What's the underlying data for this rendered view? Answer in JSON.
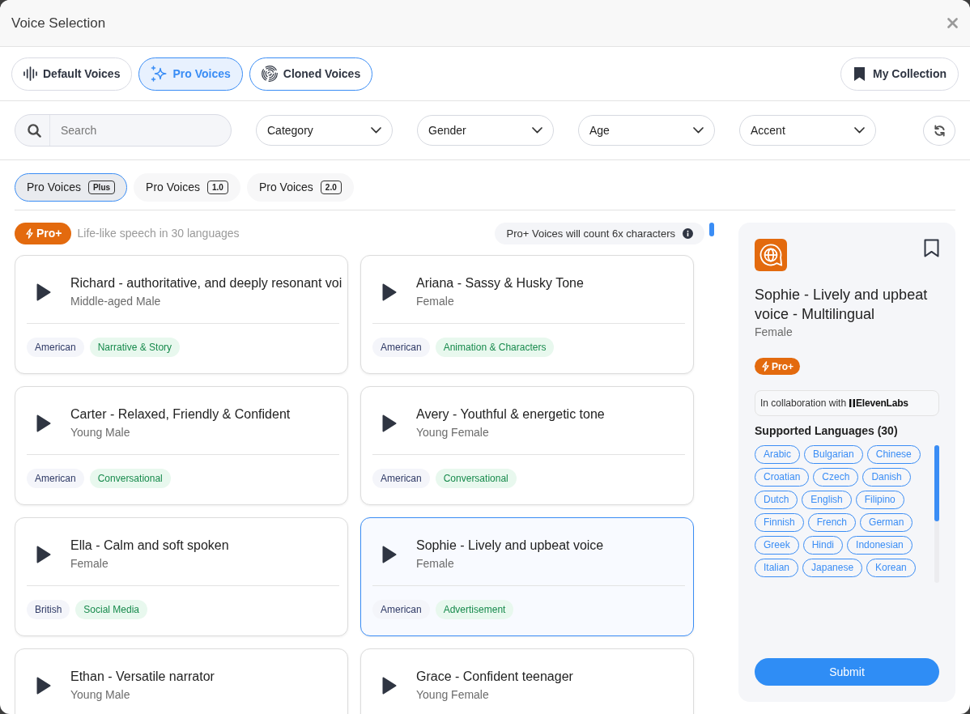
{
  "window": {
    "title": "Voice Selection"
  },
  "voice_tabs": [
    {
      "label": "Default Voices",
      "selected": false,
      "focused": false
    },
    {
      "label": "Pro Voices",
      "selected": true,
      "focused": false
    },
    {
      "label": "Cloned Voices",
      "selected": false,
      "focused": true
    }
  ],
  "collection_button": {
    "label": "My Collection"
  },
  "filters": {
    "search": {
      "placeholder": "Search"
    },
    "dropdowns": [
      {
        "label": "Category"
      },
      {
        "label": "Gender"
      },
      {
        "label": "Age"
      },
      {
        "label": "Accent"
      }
    ]
  },
  "sub_tabs": [
    {
      "label": "Pro Voices",
      "badge": "Plus",
      "selected": true
    },
    {
      "label": "Pro Voices",
      "badge": "1.0",
      "selected": false
    },
    {
      "label": "Pro Voices",
      "badge": "2.0",
      "selected": false
    }
  ],
  "tier_banner": {
    "badge": "Pro+",
    "description": "Life-like speech in 30 languages",
    "notice": "Pro+ Voices will count 6x characters"
  },
  "voices": [
    {
      "title": "Richard - authoritative, and deeply resonant voi",
      "subtitle": "Middle-aged Male",
      "tags": [
        {
          "label": "American",
          "kind": "accent"
        },
        {
          "label": "Narrative & Story",
          "kind": "category"
        }
      ],
      "selected": false
    },
    {
      "title": "Ariana - Sassy & Husky Tone",
      "subtitle": "Female",
      "tags": [
        {
          "label": "American",
          "kind": "accent"
        },
        {
          "label": "Animation & Characters",
          "kind": "category"
        }
      ],
      "selected": false
    },
    {
      "title": "Carter - Relaxed, Friendly & Confident",
      "subtitle": "Young Male",
      "tags": [
        {
          "label": "American",
          "kind": "accent"
        },
        {
          "label": "Conversational",
          "kind": "category"
        }
      ],
      "selected": false
    },
    {
      "title": "Avery - Youthful & energetic tone",
      "subtitle": "Young Female",
      "tags": [
        {
          "label": "American",
          "kind": "accent"
        },
        {
          "label": "Conversational",
          "kind": "category"
        }
      ],
      "selected": false
    },
    {
      "title": "Ella - Calm and soft spoken",
      "subtitle": "Female",
      "tags": [
        {
          "label": "British",
          "kind": "accent"
        },
        {
          "label": "Social Media",
          "kind": "category"
        }
      ],
      "selected": false
    },
    {
      "title": "Sophie - Lively and upbeat voice",
      "subtitle": "Female",
      "tags": [
        {
          "label": "American",
          "kind": "accent"
        },
        {
          "label": "Advertisement",
          "kind": "category"
        }
      ],
      "selected": true
    },
    {
      "title": "Ethan - Versatile narrator",
      "subtitle": "Young Male",
      "selected": false
    },
    {
      "title": "Grace - Confident teenager",
      "subtitle": "Young Female",
      "selected": false
    }
  ],
  "details": {
    "title": "Sophie - Lively and upbeat voice - Multilingual",
    "subtitle": "Female",
    "bookmarked": false,
    "badge": "Pro+",
    "collaboration": {
      "text": "In collaboration with",
      "partner": "ElevenLabs"
    },
    "languages_heading": "Supported Languages (30)",
    "languages": [
      "Arabic",
      "Bulgarian",
      "Chinese",
      "Croatian",
      "Czech",
      "Danish",
      "Dutch",
      "English",
      "Filipino",
      "Finnish",
      "French",
      "German",
      "Greek",
      "Hindi",
      "Indonesian",
      "Italian",
      "Japanese",
      "Korean"
    ],
    "submit": "Submit"
  }
}
